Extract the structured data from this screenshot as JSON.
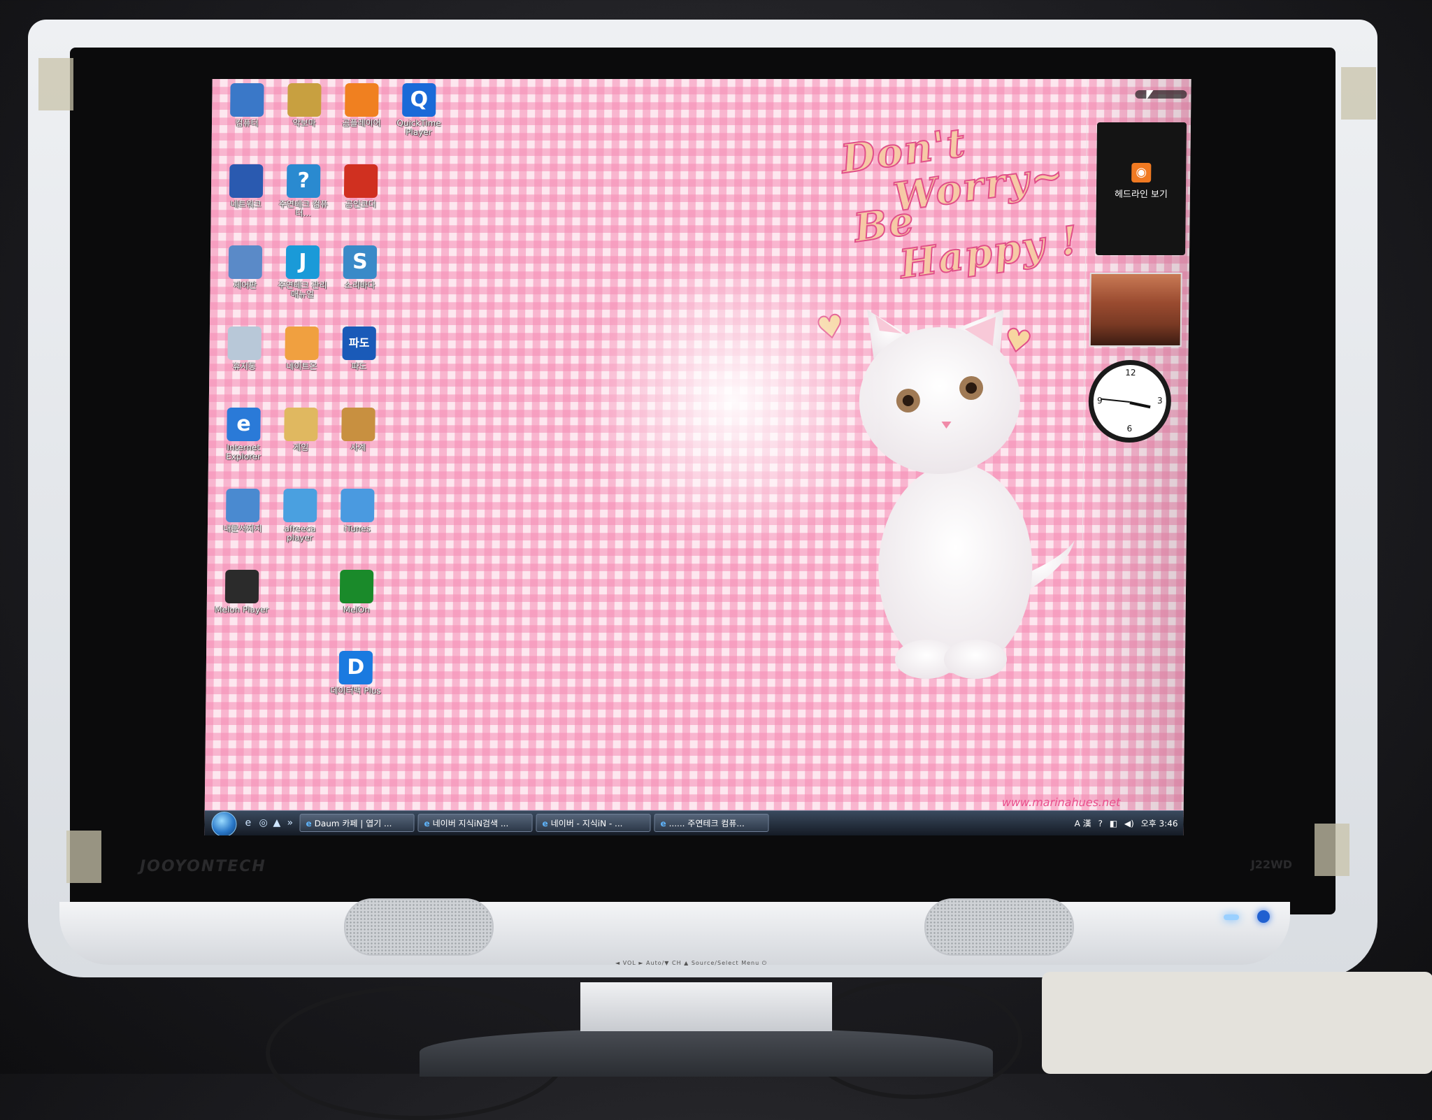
{
  "desktop_icons": [
    {
      "label": "컴퓨터",
      "icon": "computer-icon",
      "color": "#3a78c8"
    },
    {
      "label": "네트워크",
      "icon": "network-icon",
      "color": "#2a5ab0"
    },
    {
      "label": "제어판",
      "icon": "control-panel-icon",
      "color": "#5a8ac8"
    },
    {
      "label": "휴지통",
      "icon": "recycle-bin-icon",
      "color": "#b8c8d8"
    },
    {
      "label": "Internet Explorer",
      "icon": "internet-explorer-icon",
      "color": "#2a7ad8"
    },
    {
      "label": "내문서지지",
      "icon": "disk-icon",
      "color": "#4a8ad0"
    },
    {
      "label": "Melon Player",
      "icon": "melon-player-icon",
      "color": "#2b2b2b"
    },
    {
      "label": "악보마",
      "icon": "books-icon",
      "color": "#c8a040"
    },
    {
      "label": "주연테크 컴퓨터...",
      "icon": "help-icon",
      "color": "#2a8ad0"
    },
    {
      "label": "주연테크 관리 매뉴얼",
      "icon": "manual-icon",
      "color": "#1a9ad8"
    },
    {
      "label": "네이트온",
      "icon": "nateon-icon",
      "color": "#f0a040"
    },
    {
      "label": "게임",
      "icon": "folder-icon",
      "color": "#e0b860"
    },
    {
      "label": "afreeca player",
      "icon": "afreeca-icon",
      "color": "#4aa0e0"
    },
    {
      "label": "곰플레이어",
      "icon": "gom-player-icon",
      "color": "#f08020"
    },
    {
      "label": "곰인코더",
      "icon": "encoder-icon",
      "color": "#d03020"
    },
    {
      "label": "소리바다",
      "icon": "soribada-icon",
      "color": "#3a8ac8"
    },
    {
      "label": "파도",
      "icon": "pado-icon",
      "color": "#1a5ab8"
    },
    {
      "label": "사계",
      "icon": "folder-icon",
      "color": "#c89040"
    },
    {
      "label": "iTunes",
      "icon": "itunes-icon",
      "color": "#4a9ae0"
    },
    {
      "label": "MelOn",
      "icon": "melon-icon",
      "color": "#1a8a2a"
    },
    {
      "label": "데이터백 Plus",
      "icon": "databack-icon",
      "color": "#1a7ae0"
    },
    {
      "label": "QuickTime Player",
      "icon": "quicktime-icon",
      "color": "#1a6ad8"
    }
  ],
  "icon_glyphs": {
    "internet-explorer-icon": "e",
    "help-icon": "?",
    "manual-icon": "J",
    "pado-icon": "파도",
    "databack-icon": "D",
    "quicktime-icon": "Q",
    "soribada-icon": "S"
  },
  "wallpaper": {
    "line1": "Don't",
    "line2": "Worry~",
    "line3": "Be",
    "line4": "Happy !",
    "watermark": "www.marinahues.net"
  },
  "gadgets": {
    "rss_label": "헤드라인 보기",
    "clock_time": "3:46"
  },
  "taskbar": {
    "quick_launch": [
      "ie-icon",
      "desktop-icon",
      "media-icon"
    ],
    "buttons": [
      "Daum 카페 | 엽기 ...",
      "네이버 지식iN검색 ...",
      "네이버 - 지식iN - ...",
      "...... 주연테크 컴퓨..."
    ],
    "tray": {
      "ime": "A 漢",
      "time": "오후 3:46"
    }
  },
  "monitor": {
    "brand": "JOOYONTECH",
    "model": "J22WD",
    "controls": "◄ VOL ►   Auto/▼   CH ▲   Source/Select   Menu   ⏻"
  }
}
